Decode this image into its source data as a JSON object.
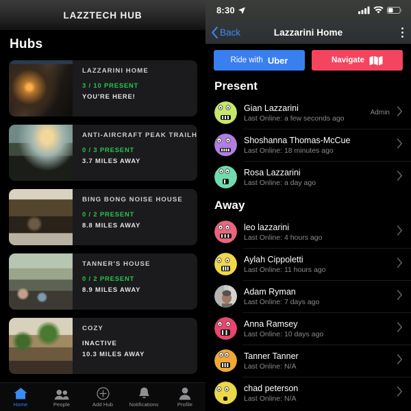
{
  "left_panel": {
    "header_title": "LAZZTECH HUB",
    "section_label": "Hubs",
    "hubs": [
      {
        "name": "LAZZARINI HOME",
        "present": "3 / 10 PRESENT",
        "status": "YOU'RE HERE!",
        "present_state": "active",
        "thumb": "living-room-lamp"
      },
      {
        "name": "ANTI-AIRCRAFT PEAK TRAILHEAD",
        "present": "0 / 3 PRESENT",
        "status": "3.7 MILES AWAY",
        "present_state": "active",
        "thumb": "deck-sunset-laptop"
      },
      {
        "name": "BING BONG NOISE HOUSE",
        "present": "0 / 2 PRESENT",
        "status": "8.8 MILES AWAY",
        "present_state": "active",
        "thumb": "cat-porch"
      },
      {
        "name": "TANNER'S HOUSE",
        "present": "0 / 2 PRESENT",
        "status": "8.9 MILES AWAY",
        "present_state": "active",
        "thumb": "street-crowd-house"
      },
      {
        "name": "COZY",
        "present": "INACTIVE",
        "status": "10.3 MILES AWAY",
        "present_state": "inactive",
        "thumb": "plants-shelf-room"
      }
    ],
    "tabs": [
      {
        "label": "Home",
        "icon": "home-icon",
        "active": true
      },
      {
        "label": "People",
        "icon": "people-icon",
        "active": false
      },
      {
        "label": "Add Hub",
        "icon": "plus-circle-icon",
        "active": false
      },
      {
        "label": "Notifications",
        "icon": "bell-icon",
        "active": false
      },
      {
        "label": "Profile",
        "icon": "person-icon",
        "active": false
      }
    ]
  },
  "right_panel": {
    "status_bar": {
      "time": "8:30",
      "location_icon": "location-arrow-icon",
      "signal_icon": "cellular-signal-icon",
      "wifi_icon": "wifi-icon",
      "battery_icon": "battery-icon",
      "battery_level": 40
    },
    "nav": {
      "back_label": "Back",
      "title": "Lazzarini Home",
      "more_icon": "more-vertical-icon"
    },
    "actions": {
      "uber_prefix": "Ride with",
      "uber_brand": "Uber",
      "uber_color": "#3a7ff0",
      "navigate_label": "Navigate",
      "navigate_icon": "map-icon",
      "navigate_color": "#f5445e"
    },
    "sections": [
      {
        "title": "Present",
        "people": [
          {
            "name": "Gian Lazzarini",
            "meta": "Last Online: a few seconds ago",
            "badge": "Admin",
            "avatar_color": "#c5e86a",
            "avatar_type": "face"
          },
          {
            "name": "Shoshanna Thomas-McCue",
            "meta": "Last Online: 18 minutes ago",
            "badge": "",
            "avatar_color": "#b07fe0",
            "avatar_type": "face"
          },
          {
            "name": "Rosa Lazzarini",
            "meta": "Last Online: a day ago",
            "badge": "",
            "avatar_color": "#6fdcb0",
            "avatar_type": "face"
          }
        ]
      },
      {
        "title": "Away",
        "people": [
          {
            "name": "leo lazzarini",
            "meta": "Last Online: 4 hours ago",
            "badge": "",
            "avatar_color": "#e8657f",
            "avatar_type": "face"
          },
          {
            "name": "Aylah Cippoletti",
            "meta": "Last Online: 11 hours ago",
            "badge": "",
            "avatar_color": "#f0d848",
            "avatar_type": "face"
          },
          {
            "name": "Adam Ryman",
            "meta": "Last Online: 7 days ago",
            "badge": "",
            "avatar_color": "#b9b9bb",
            "avatar_type": "photo"
          },
          {
            "name": "Anna Ramsey",
            "meta": "Last Online: 10 days ago",
            "badge": "",
            "avatar_color": "#e8456f",
            "avatar_type": "face"
          },
          {
            "name": "Tanner Tanner",
            "meta": "Last Online: N/A",
            "badge": "",
            "avatar_color": "#f0a838",
            "avatar_type": "face"
          },
          {
            "name": "chad peterson",
            "meta": "Last Online: N/A",
            "badge": "",
            "avatar_color": "#ead84a",
            "avatar_type": "face"
          }
        ]
      }
    ]
  }
}
